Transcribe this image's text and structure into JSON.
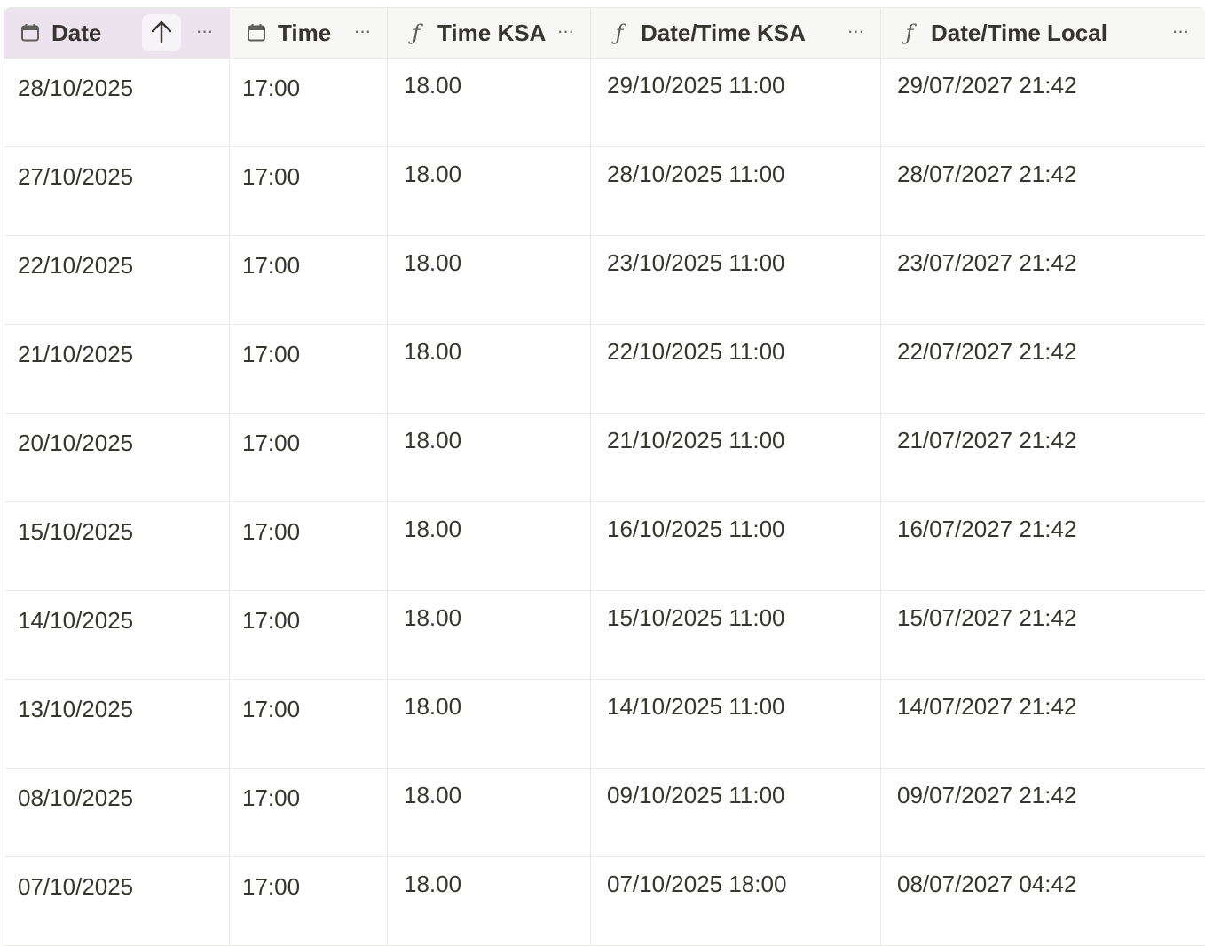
{
  "columns": [
    {
      "label": "Date",
      "icon": "calendar-icon",
      "sorted": "ascending"
    },
    {
      "label": "Time",
      "icon": "calendar-icon"
    },
    {
      "label": "Time KSA",
      "icon": "formula-icon"
    },
    {
      "label": "Date/Time KSA",
      "icon": "formula-icon"
    },
    {
      "label": "Date/Time Local",
      "icon": "formula-icon"
    }
  ],
  "more_label": "···",
  "rows": [
    {
      "date": "28/10/2025",
      "time": "17:00",
      "time_ksa": "18.00",
      "datetime_ksa": "29/10/2025 11:00",
      "datetime_local": "29/07/2027 21:42"
    },
    {
      "date": "27/10/2025",
      "time": "17:00",
      "time_ksa": "18.00",
      "datetime_ksa": "28/10/2025 11:00",
      "datetime_local": "28/07/2027 21:42"
    },
    {
      "date": "22/10/2025",
      "time": "17:00",
      "time_ksa": "18.00",
      "datetime_ksa": "23/10/2025 11:00",
      "datetime_local": "23/07/2027 21:42"
    },
    {
      "date": "21/10/2025",
      "time": "17:00",
      "time_ksa": "18.00",
      "datetime_ksa": "22/10/2025 11:00",
      "datetime_local": "22/07/2027 21:42"
    },
    {
      "date": "20/10/2025",
      "time": "17:00",
      "time_ksa": "18.00",
      "datetime_ksa": "21/10/2025 11:00",
      "datetime_local": "21/07/2027 21:42"
    },
    {
      "date": "15/10/2025",
      "time": "17:00",
      "time_ksa": "18.00",
      "datetime_ksa": "16/10/2025 11:00",
      "datetime_local": "16/07/2027 21:42"
    },
    {
      "date": "14/10/2025",
      "time": "17:00",
      "time_ksa": "18.00",
      "datetime_ksa": "15/10/2025 11:00",
      "datetime_local": "15/07/2027 21:42"
    },
    {
      "date": "13/10/2025",
      "time": "17:00",
      "time_ksa": "18.00",
      "datetime_ksa": "14/10/2025 11:00",
      "datetime_local": "14/07/2027 21:42"
    },
    {
      "date": "08/10/2025",
      "time": "17:00",
      "time_ksa": "18.00",
      "datetime_ksa": "09/10/2025 11:00",
      "datetime_local": "09/07/2027 21:42"
    },
    {
      "date": "07/10/2025",
      "time": "17:00",
      "time_ksa": "18.00",
      "datetime_ksa": "07/10/2025 18:00",
      "datetime_local": "08/07/2027 04:42"
    }
  ]
}
